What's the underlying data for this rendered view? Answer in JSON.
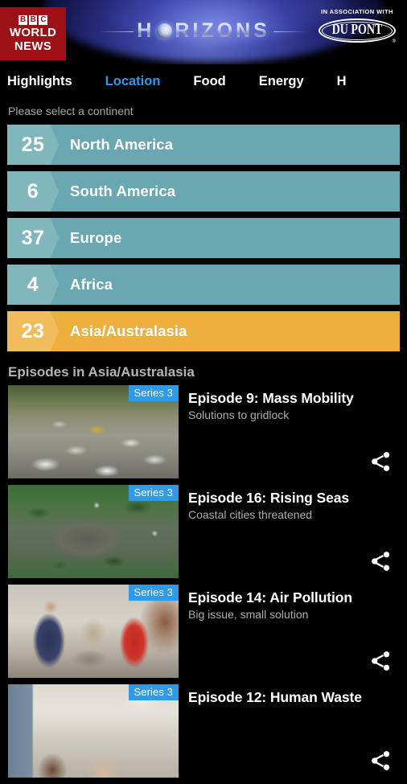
{
  "header": {
    "bbc_logo": {
      "letters": [
        "B",
        "B",
        "C"
      ],
      "line1": "WORLD",
      "line2": "NEWS"
    },
    "programme_title": "HORIZONS",
    "programme_title_parts": {
      "before": "H",
      "after": "RIZONS"
    },
    "sponsor": {
      "assoc_label": "IN ASSOCIATION WITH",
      "brand": "DU PONT",
      "registered_mark": "®"
    }
  },
  "nav": {
    "tabs": [
      {
        "label": "Highlights",
        "active": false
      },
      {
        "label": "Location",
        "active": true
      },
      {
        "label": "Food",
        "active": false
      },
      {
        "label": "Energy",
        "active": false
      },
      {
        "label": "H",
        "active": false,
        "clipped": true
      }
    ],
    "active_color": "#2e9bea"
  },
  "main": {
    "prompt": "Please select a continent",
    "continent_colors": {
      "default": "#69a8b0",
      "selected": "#eeb03c"
    },
    "continents": [
      {
        "count": "25",
        "name": "North America",
        "selected": false
      },
      {
        "count": "6",
        "name": "South America",
        "selected": false
      },
      {
        "count": "37",
        "name": "Europe",
        "selected": false
      },
      {
        "count": "4",
        "name": "Africa",
        "selected": false
      },
      {
        "count": "23",
        "name": "Asia/Australasia",
        "selected": true
      }
    ],
    "episodes_heading": "Episodes in Asia/Australasia",
    "series_badge_color": "#2e9bea",
    "episodes": [
      {
        "series": "Series 3",
        "title": "Episode 9: Mass Mobility",
        "subtitle": "Solutions to gridlock",
        "share_icon": "share-icon",
        "art": "art-traffic"
      },
      {
        "series": "Series 3",
        "title": "Episode 16: Rising Seas",
        "subtitle": "Coastal cities threatened",
        "share_icon": "share-icon",
        "art": "art-flood"
      },
      {
        "series": "Series 3",
        "title": "Episode 14: Air Pollution",
        "subtitle": "Big issue, small solution",
        "share_icon": "share-icon",
        "art": "art-pollution"
      },
      {
        "series": "Series 3",
        "title": "Episode 12: Human Waste",
        "subtitle": "",
        "share_icon": "share-icon",
        "art": "art-waste"
      }
    ]
  }
}
